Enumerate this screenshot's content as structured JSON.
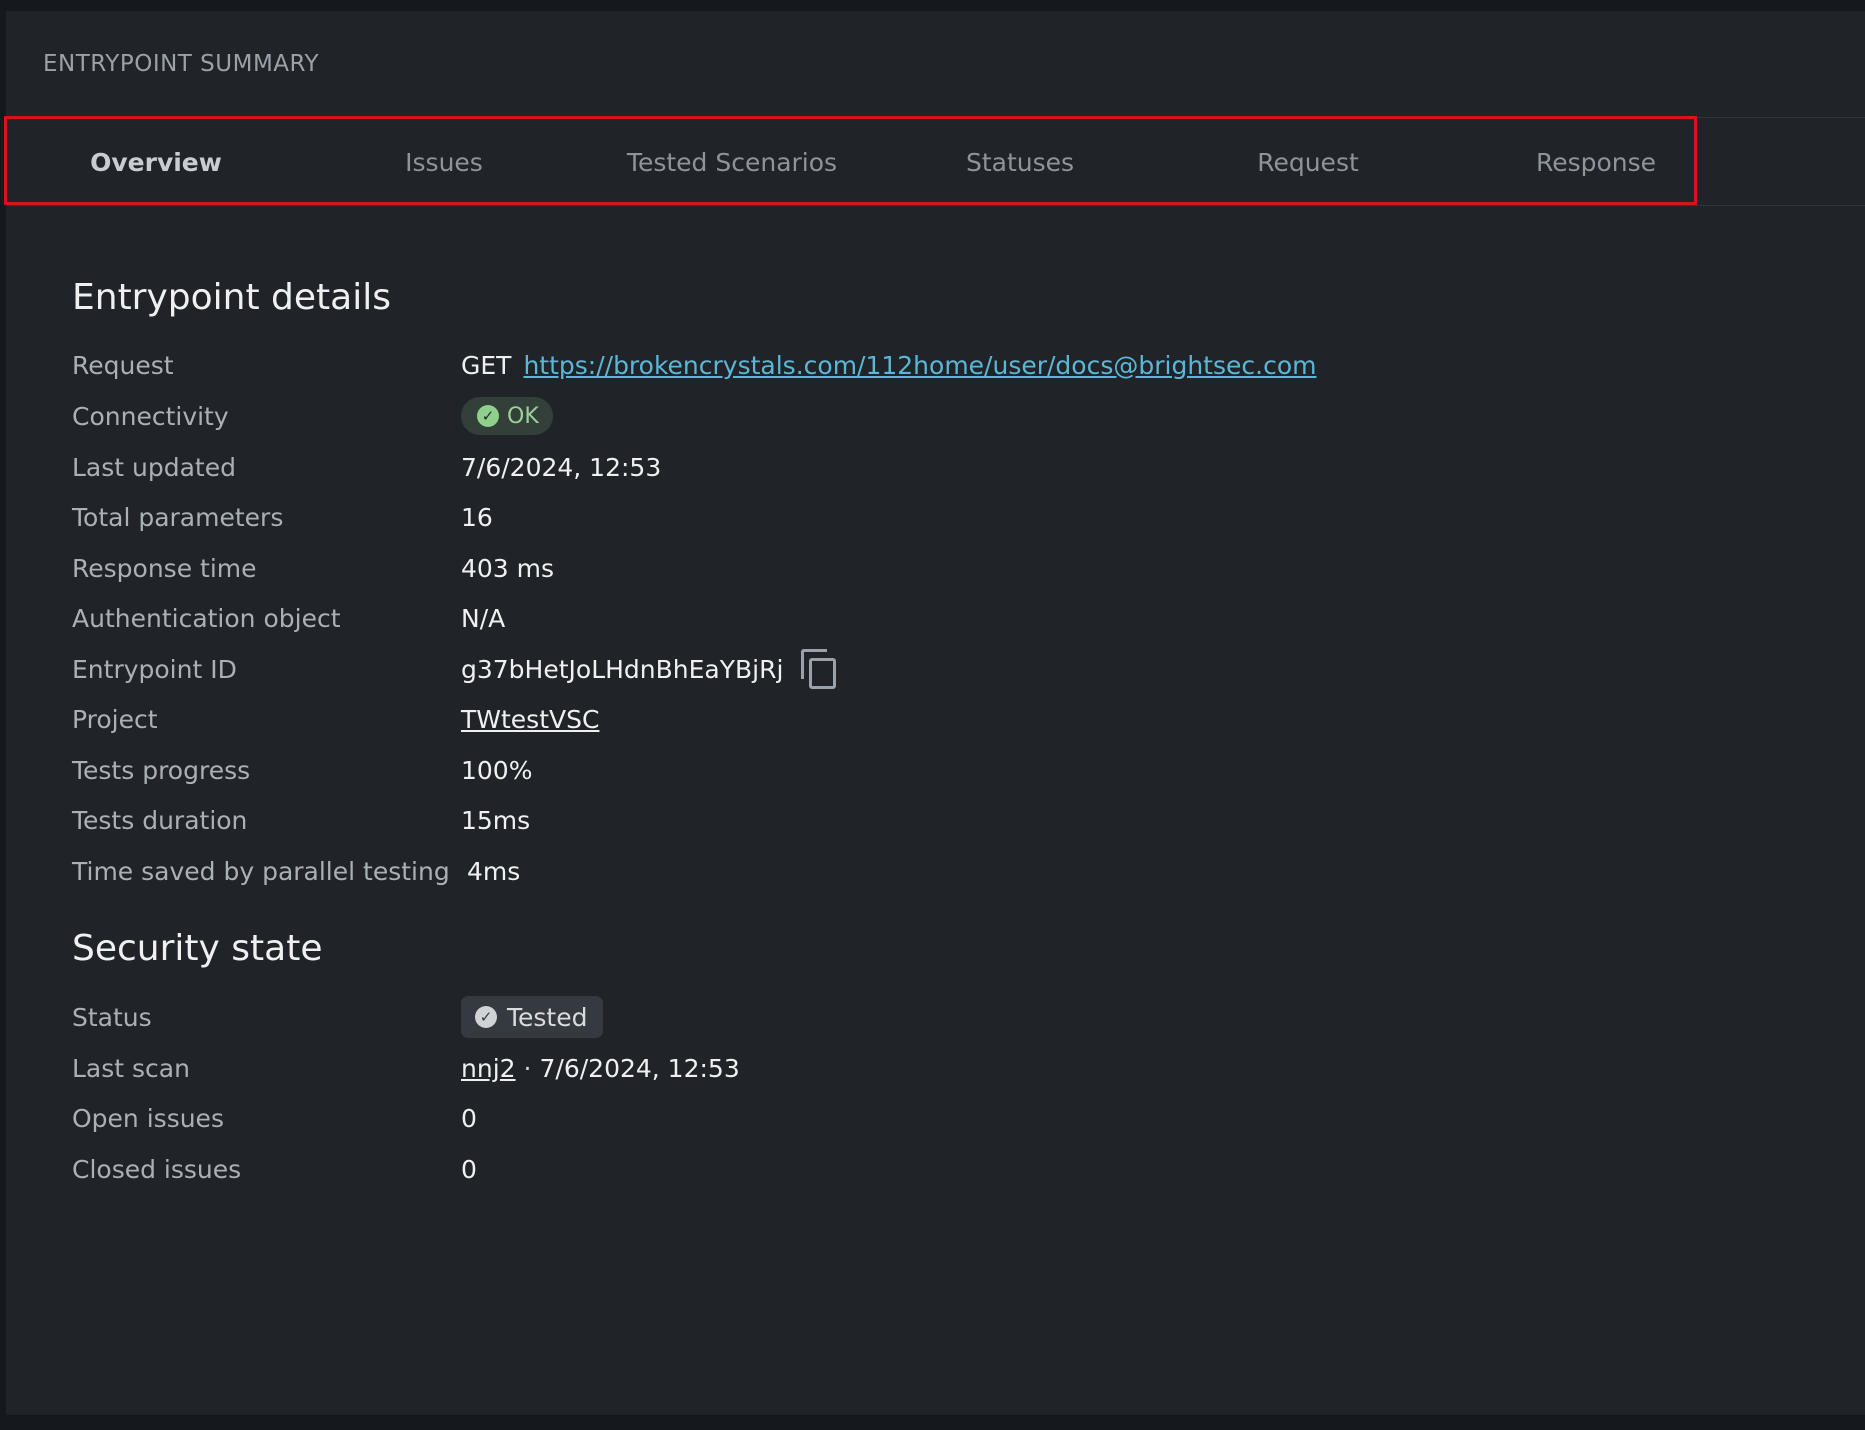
{
  "header": {
    "title": "ENTRYPOINT SUMMARY"
  },
  "tabs": [
    {
      "label": "Overview",
      "active": true
    },
    {
      "label": "Issues",
      "active": false
    },
    {
      "label": "Tested Scenarios",
      "active": false
    },
    {
      "label": "Statuses",
      "active": false
    },
    {
      "label": "Request",
      "active": false
    },
    {
      "label": "Response",
      "active": false
    }
  ],
  "details": {
    "title": "Entrypoint details",
    "request": {
      "label": "Request",
      "method": "GET",
      "url": "https://brokencrystals.com/112home/user/docs@brightsec.com"
    },
    "connectivity": {
      "label": "Connectivity",
      "value": "OK"
    },
    "last_updated": {
      "label": "Last updated",
      "value": "7/6/2024, 12:53"
    },
    "total_parameters": {
      "label": "Total parameters",
      "value": "16"
    },
    "response_time": {
      "label": "Response time",
      "value": "403 ms"
    },
    "auth_object": {
      "label": "Authentication object",
      "value": "N/A"
    },
    "entrypoint_id": {
      "label": "Entrypoint ID",
      "value": "g37bHetJoLHdnBhEaYBjRj"
    },
    "project": {
      "label": "Project",
      "value": "TWtestVSC"
    },
    "tests_progress": {
      "label": "Tests progress",
      "value": "100%"
    },
    "tests_duration": {
      "label": "Tests duration",
      "value": "15ms"
    },
    "time_saved": {
      "label": "Time saved by parallel testing",
      "value": "4ms"
    }
  },
  "security": {
    "title": "Security state",
    "status": {
      "label": "Status",
      "value": "Tested"
    },
    "last_scan": {
      "label": "Last scan",
      "scan_name": "nnj2",
      "separator": "·",
      "date": "7/6/2024, 12:53"
    },
    "open_issues": {
      "label": "Open issues",
      "value": "0"
    },
    "closed_issues": {
      "label": "Closed issues",
      "value": "0"
    }
  },
  "colors": {
    "background": "#202429",
    "accent_link": "#5bb7d6",
    "ok_badge": "#33403a",
    "highlight": "#d8121f"
  }
}
